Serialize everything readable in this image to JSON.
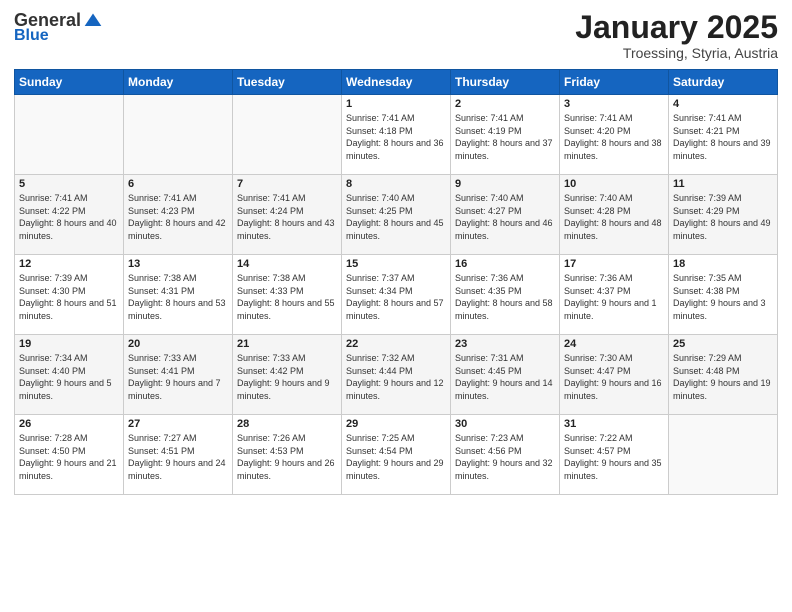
{
  "logo": {
    "general": "General",
    "blue": "Blue"
  },
  "header": {
    "title": "January 2025",
    "subtitle": "Troessing, Styria, Austria"
  },
  "columns": [
    "Sunday",
    "Monday",
    "Tuesday",
    "Wednesday",
    "Thursday",
    "Friday",
    "Saturday"
  ],
  "weeks": [
    [
      {
        "day": "",
        "info": ""
      },
      {
        "day": "",
        "info": ""
      },
      {
        "day": "",
        "info": ""
      },
      {
        "day": "1",
        "info": "Sunrise: 7:41 AM\nSunset: 4:18 PM\nDaylight: 8 hours\nand 36 minutes."
      },
      {
        "day": "2",
        "info": "Sunrise: 7:41 AM\nSunset: 4:19 PM\nDaylight: 8 hours\nand 37 minutes."
      },
      {
        "day": "3",
        "info": "Sunrise: 7:41 AM\nSunset: 4:20 PM\nDaylight: 8 hours\nand 38 minutes."
      },
      {
        "day": "4",
        "info": "Sunrise: 7:41 AM\nSunset: 4:21 PM\nDaylight: 8 hours\nand 39 minutes."
      }
    ],
    [
      {
        "day": "5",
        "info": "Sunrise: 7:41 AM\nSunset: 4:22 PM\nDaylight: 8 hours\nand 40 minutes."
      },
      {
        "day": "6",
        "info": "Sunrise: 7:41 AM\nSunset: 4:23 PM\nDaylight: 8 hours\nand 42 minutes."
      },
      {
        "day": "7",
        "info": "Sunrise: 7:41 AM\nSunset: 4:24 PM\nDaylight: 8 hours\nand 43 minutes."
      },
      {
        "day": "8",
        "info": "Sunrise: 7:40 AM\nSunset: 4:25 PM\nDaylight: 8 hours\nand 45 minutes."
      },
      {
        "day": "9",
        "info": "Sunrise: 7:40 AM\nSunset: 4:27 PM\nDaylight: 8 hours\nand 46 minutes."
      },
      {
        "day": "10",
        "info": "Sunrise: 7:40 AM\nSunset: 4:28 PM\nDaylight: 8 hours\nand 48 minutes."
      },
      {
        "day": "11",
        "info": "Sunrise: 7:39 AM\nSunset: 4:29 PM\nDaylight: 8 hours\nand 49 minutes."
      }
    ],
    [
      {
        "day": "12",
        "info": "Sunrise: 7:39 AM\nSunset: 4:30 PM\nDaylight: 8 hours\nand 51 minutes."
      },
      {
        "day": "13",
        "info": "Sunrise: 7:38 AM\nSunset: 4:31 PM\nDaylight: 8 hours\nand 53 minutes."
      },
      {
        "day": "14",
        "info": "Sunrise: 7:38 AM\nSunset: 4:33 PM\nDaylight: 8 hours\nand 55 minutes."
      },
      {
        "day": "15",
        "info": "Sunrise: 7:37 AM\nSunset: 4:34 PM\nDaylight: 8 hours\nand 57 minutes."
      },
      {
        "day": "16",
        "info": "Sunrise: 7:36 AM\nSunset: 4:35 PM\nDaylight: 8 hours\nand 58 minutes."
      },
      {
        "day": "17",
        "info": "Sunrise: 7:36 AM\nSunset: 4:37 PM\nDaylight: 9 hours\nand 1 minute."
      },
      {
        "day": "18",
        "info": "Sunrise: 7:35 AM\nSunset: 4:38 PM\nDaylight: 9 hours\nand 3 minutes."
      }
    ],
    [
      {
        "day": "19",
        "info": "Sunrise: 7:34 AM\nSunset: 4:40 PM\nDaylight: 9 hours\nand 5 minutes."
      },
      {
        "day": "20",
        "info": "Sunrise: 7:33 AM\nSunset: 4:41 PM\nDaylight: 9 hours\nand 7 minutes."
      },
      {
        "day": "21",
        "info": "Sunrise: 7:33 AM\nSunset: 4:42 PM\nDaylight: 9 hours\nand 9 minutes."
      },
      {
        "day": "22",
        "info": "Sunrise: 7:32 AM\nSunset: 4:44 PM\nDaylight: 9 hours\nand 12 minutes."
      },
      {
        "day": "23",
        "info": "Sunrise: 7:31 AM\nSunset: 4:45 PM\nDaylight: 9 hours\nand 14 minutes."
      },
      {
        "day": "24",
        "info": "Sunrise: 7:30 AM\nSunset: 4:47 PM\nDaylight: 9 hours\nand 16 minutes."
      },
      {
        "day": "25",
        "info": "Sunrise: 7:29 AM\nSunset: 4:48 PM\nDaylight: 9 hours\nand 19 minutes."
      }
    ],
    [
      {
        "day": "26",
        "info": "Sunrise: 7:28 AM\nSunset: 4:50 PM\nDaylight: 9 hours\nand 21 minutes."
      },
      {
        "day": "27",
        "info": "Sunrise: 7:27 AM\nSunset: 4:51 PM\nDaylight: 9 hours\nand 24 minutes."
      },
      {
        "day": "28",
        "info": "Sunrise: 7:26 AM\nSunset: 4:53 PM\nDaylight: 9 hours\nand 26 minutes."
      },
      {
        "day": "29",
        "info": "Sunrise: 7:25 AM\nSunset: 4:54 PM\nDaylight: 9 hours\nand 29 minutes."
      },
      {
        "day": "30",
        "info": "Sunrise: 7:23 AM\nSunset: 4:56 PM\nDaylight: 9 hours\nand 32 minutes."
      },
      {
        "day": "31",
        "info": "Sunrise: 7:22 AM\nSunset: 4:57 PM\nDaylight: 9 hours\nand 35 minutes."
      },
      {
        "day": "",
        "info": ""
      }
    ]
  ]
}
